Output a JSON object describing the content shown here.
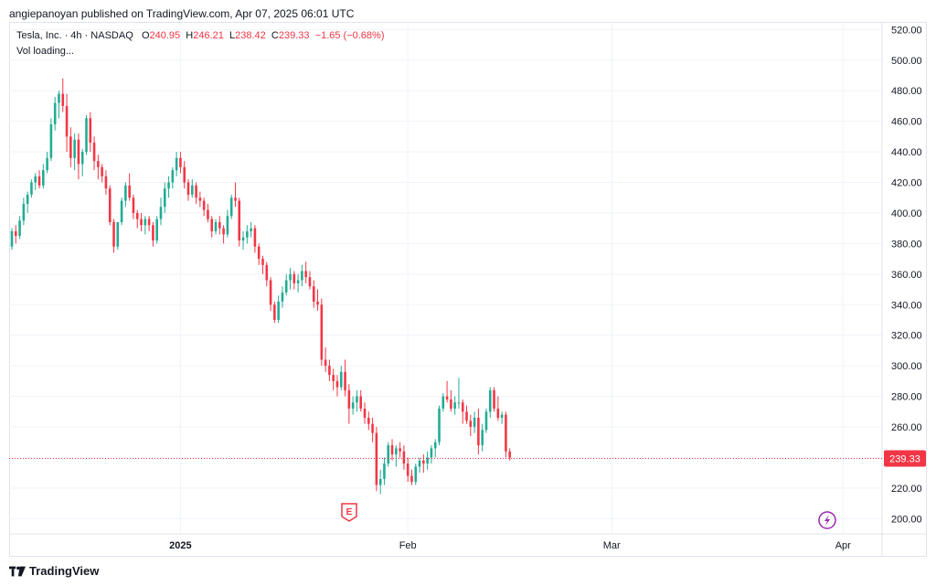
{
  "publisher": "angiepanoyan published on TradingView.com, Apr 07, 2025 06:01 UTC",
  "legend": {
    "symbol": "Tesla, Inc. · 4h · NASDAQ",
    "o_label": "O",
    "o": "240.95",
    "h_label": "H",
    "h": "246.21",
    "l_label": "L",
    "l": "238.42",
    "c_label": "C",
    "c": "239.33",
    "change": "−1.65 (−0.68%)"
  },
  "vol_text": "Vol loading...",
  "footer": {
    "brand": "TradingView"
  },
  "colors": {
    "up": "#22ab94",
    "down": "#f23645",
    "grid": "#f0f3fa",
    "axis_text": "#131722"
  },
  "events": {
    "earnings_letter": "E"
  },
  "chart_data": {
    "type": "candlestick",
    "ylim": [
      190,
      525
    ],
    "yticks": [
      200,
      220,
      240,
      260,
      280,
      300,
      320,
      340,
      360,
      380,
      400,
      420,
      440,
      460,
      480,
      500,
      520
    ],
    "ytick_labels": [
      "200.00",
      "220.00",
      "240.00",
      "260.00",
      "280.00",
      "300.00",
      "320.00",
      "340.00",
      "360.00",
      "380.00",
      "400.00",
      "420.00",
      "440.00",
      "460.00",
      "480.00",
      "500.00",
      "520.00"
    ],
    "xticks": [
      {
        "label": "2025",
        "bar": 43
      },
      {
        "label": "Feb",
        "bar": 101
      },
      {
        "label": "Mar",
        "bar": 153
      },
      {
        "label": "Apr",
        "bar": 212
      }
    ],
    "last_price": 239.33,
    "last_price_label": "239.33",
    "candles": [
      [
        378,
        390,
        376,
        388
      ],
      [
        388,
        392,
        380,
        385
      ],
      [
        385,
        398,
        383,
        395
      ],
      [
        395,
        410,
        392,
        406
      ],
      [
        406,
        414,
        400,
        412
      ],
      [
        412,
        422,
        410,
        420
      ],
      [
        420,
        426,
        415,
        424
      ],
      [
        424,
        428,
        416,
        418
      ],
      [
        418,
        432,
        416,
        428
      ],
      [
        428,
        440,
        426,
        436
      ],
      [
        436,
        462,
        434,
        458
      ],
      [
        458,
        476,
        454,
        472
      ],
      [
        472,
        480,
        462,
        478
      ],
      [
        478,
        488,
        466,
        470
      ],
      [
        470,
        478,
        440,
        450
      ],
      [
        450,
        456,
        430,
        436
      ],
      [
        436,
        452,
        428,
        448
      ],
      [
        448,
        452,
        422,
        432
      ],
      [
        432,
        442,
        424,
        440
      ],
      [
        440,
        464,
        438,
        462
      ],
      [
        462,
        466,
        440,
        446
      ],
      [
        446,
        450,
        428,
        434
      ],
      [
        434,
        438,
        422,
        430
      ],
      [
        430,
        432,
        420,
        424
      ],
      [
        424,
        428,
        412,
        416
      ],
      [
        416,
        418,
        392,
        394
      ],
      [
        394,
        396,
        374,
        378
      ],
      [
        378,
        392,
        376,
        394
      ],
      [
        394,
        410,
        392,
        408
      ],
      [
        408,
        420,
        404,
        418
      ],
      [
        418,
        426,
        408,
        410
      ],
      [
        410,
        412,
        396,
        400
      ],
      [
        400,
        402,
        390,
        396
      ],
      [
        396,
        400,
        388,
        392
      ],
      [
        392,
        398,
        386,
        396
      ],
      [
        396,
        398,
        388,
        392
      ],
      [
        392,
        394,
        378,
        382
      ],
      [
        382,
        398,
        380,
        396
      ],
      [
        396,
        410,
        392,
        404
      ],
      [
        404,
        420,
        400,
        416
      ],
      [
        416,
        424,
        410,
        420
      ],
      [
        420,
        430,
        416,
        428
      ],
      [
        428,
        440,
        424,
        436
      ],
      [
        436,
        440,
        426,
        430
      ],
      [
        430,
        434,
        416,
        420
      ],
      [
        420,
        422,
        408,
        412
      ],
      [
        412,
        422,
        410,
        418
      ],
      [
        418,
        420,
        406,
        410
      ],
      [
        410,
        414,
        404,
        408
      ],
      [
        408,
        410,
        398,
        402
      ],
      [
        402,
        406,
        394,
        396
      ],
      [
        396,
        398,
        384,
        388
      ],
      [
        388,
        396,
        386,
        394
      ],
      [
        394,
        398,
        386,
        390
      ],
      [
        390,
        392,
        380,
        386
      ],
      [
        386,
        402,
        384,
        398
      ],
      [
        398,
        412,
        396,
        410
      ],
      [
        410,
        420,
        404,
        408
      ],
      [
        408,
        410,
        378,
        382
      ],
      [
        382,
        388,
        376,
        384
      ],
      [
        384,
        392,
        380,
        388
      ],
      [
        388,
        394,
        384,
        390
      ],
      [
        390,
        392,
        374,
        378
      ],
      [
        378,
        380,
        366,
        370
      ],
      [
        370,
        372,
        360,
        366
      ],
      [
        366,
        368,
        352,
        356
      ],
      [
        356,
        358,
        336,
        340
      ],
      [
        340,
        342,
        328,
        330
      ],
      [
        330,
        346,
        328,
        342
      ],
      [
        342,
        352,
        338,
        348
      ],
      [
        348,
        360,
        346,
        356
      ],
      [
        356,
        364,
        350,
        360
      ],
      [
        360,
        362,
        350,
        354
      ],
      [
        354,
        360,
        348,
        356
      ],
      [
        356,
        366,
        352,
        362
      ],
      [
        362,
        368,
        354,
        358
      ],
      [
        358,
        362,
        350,
        352
      ],
      [
        352,
        356,
        338,
        342
      ],
      [
        342,
        350,
        336,
        340
      ],
      [
        340,
        344,
        300,
        304
      ],
      [
        304,
        312,
        296,
        300
      ],
      [
        300,
        304,
        290,
        294
      ],
      [
        294,
        298,
        284,
        290
      ],
      [
        290,
        294,
        280,
        286
      ],
      [
        286,
        300,
        284,
        296
      ],
      [
        296,
        304,
        280,
        284
      ],
      [
        284,
        288,
        262,
        272
      ],
      [
        272,
        280,
        268,
        276
      ],
      [
        276,
        284,
        270,
        280
      ],
      [
        280,
        284,
        270,
        272
      ],
      [
        272,
        276,
        262,
        266
      ],
      [
        266,
        270,
        258,
        262
      ],
      [
        262,
        266,
        250,
        256
      ],
      [
        256,
        260,
        218,
        222
      ],
      [
        222,
        232,
        216,
        226
      ],
      [
        226,
        240,
        222,
        236
      ],
      [
        236,
        250,
        234,
        248
      ],
      [
        248,
        252,
        238,
        242
      ],
      [
        242,
        248,
        234,
        246
      ],
      [
        246,
        250,
        240,
        244
      ],
      [
        244,
        248,
        232,
        236
      ],
      [
        236,
        240,
        224,
        228
      ],
      [
        228,
        232,
        222,
        224
      ],
      [
        224,
        236,
        222,
        234
      ],
      [
        234,
        240,
        230,
        238
      ],
      [
        238,
        242,
        230,
        236
      ],
      [
        236,
        244,
        232,
        240
      ],
      [
        240,
        248,
        236,
        246
      ],
      [
        246,
        252,
        240,
        250
      ],
      [
        250,
        274,
        248,
        272
      ],
      [
        272,
        282,
        270,
        280
      ],
      [
        280,
        290,
        276,
        278
      ],
      [
        278,
        284,
        270,
        272
      ],
      [
        272,
        280,
        268,
        276
      ],
      [
        276,
        292,
        272,
        276
      ],
      [
        276,
        278,
        262,
        270
      ],
      [
        270,
        274,
        262,
        264
      ],
      [
        264,
        268,
        254,
        260
      ],
      [
        260,
        270,
        256,
        266
      ],
      [
        266,
        272,
        242,
        248
      ],
      [
        248,
        262,
        244,
        258
      ],
      [
        258,
        272,
        256,
        270
      ],
      [
        270,
        286,
        266,
        284
      ],
      [
        284,
        286,
        270,
        272
      ],
      [
        272,
        280,
        264,
        266
      ],
      [
        266,
        270,
        262,
        268
      ],
      [
        268,
        270,
        240,
        244
      ],
      [
        244,
        246,
        238,
        240
      ]
    ]
  }
}
